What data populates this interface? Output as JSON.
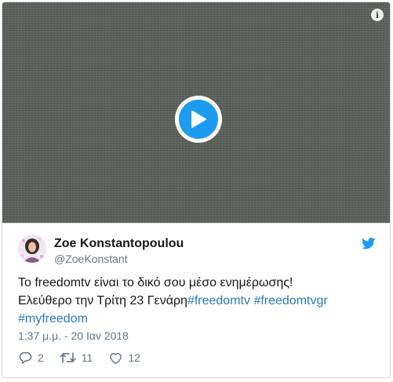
{
  "media": {
    "info_icon": "info-icon",
    "play_icon": "play-icon"
  },
  "author": {
    "name": "Zoe Konstantopoulou",
    "handle": "@ZoeKonstant"
  },
  "tweet": {
    "line1": "Το freedomtv είναι το δικό σου μέσο ενημέρωσης!",
    "line2_text": "Ελεύθερο την Τρίτη 23 Γενάρη",
    "hashtag1": "#freedomtv",
    "hashtag2": "#freedomtvgr",
    "hashtag3": "#myfreedom",
    "timestamp": "1:37 μ.μ. - 20 Ιαν 2018"
  },
  "actions": {
    "replies": "2",
    "retweets": "11",
    "likes": "12"
  },
  "colors": {
    "accent": "#1d9bf0",
    "hashtag": "#2b7bb9",
    "muted": "#657786"
  }
}
